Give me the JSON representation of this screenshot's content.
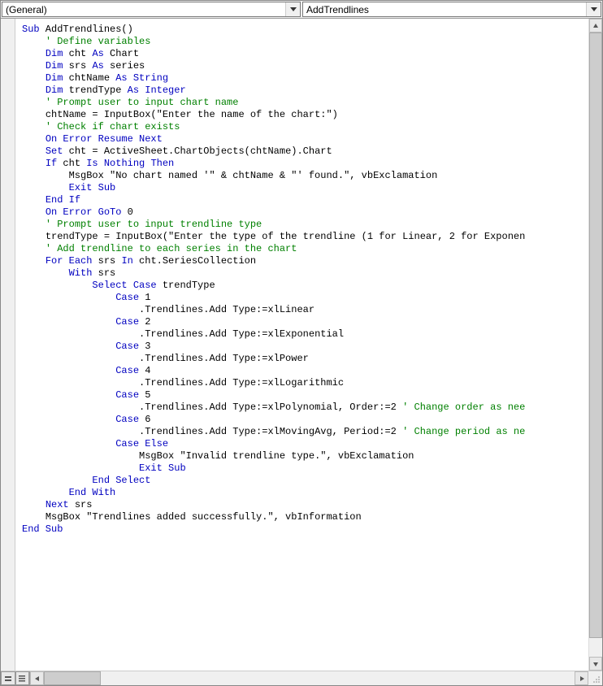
{
  "dropdowns": {
    "object": "(General)",
    "procedure": "AddTrendlines"
  },
  "code": {
    "lines": [
      {
        "indent": 0,
        "segs": [
          {
            "c": "kw",
            "t": "Sub"
          },
          {
            "c": "ms",
            "t": " AddTrendlines()"
          }
        ]
      },
      {
        "indent": 0,
        "segs": []
      },
      {
        "indent": 1,
        "segs": [
          {
            "c": "cm",
            "t": "' Define variables"
          }
        ]
      },
      {
        "indent": 1,
        "segs": [
          {
            "c": "kw",
            "t": "Dim"
          },
          {
            "c": "ms",
            "t": " cht "
          },
          {
            "c": "kw",
            "t": "As"
          },
          {
            "c": "ms",
            "t": " Chart"
          }
        ]
      },
      {
        "indent": 1,
        "segs": [
          {
            "c": "kw",
            "t": "Dim"
          },
          {
            "c": "ms",
            "t": " srs "
          },
          {
            "c": "kw",
            "t": "As"
          },
          {
            "c": "ms",
            "t": " series"
          }
        ]
      },
      {
        "indent": 1,
        "segs": [
          {
            "c": "kw",
            "t": "Dim"
          },
          {
            "c": "ms",
            "t": " chtName "
          },
          {
            "c": "kw",
            "t": "As String"
          }
        ]
      },
      {
        "indent": 1,
        "segs": [
          {
            "c": "kw",
            "t": "Dim"
          },
          {
            "c": "ms",
            "t": " trendType "
          },
          {
            "c": "kw",
            "t": "As Integer"
          }
        ]
      },
      {
        "indent": 0,
        "segs": []
      },
      {
        "indent": 1,
        "segs": [
          {
            "c": "cm",
            "t": "' Prompt user to input chart name"
          }
        ]
      },
      {
        "indent": 1,
        "segs": [
          {
            "c": "ms",
            "t": "chtName = InputBox(\"Enter the name of the chart:\")"
          }
        ]
      },
      {
        "indent": 0,
        "segs": []
      },
      {
        "indent": 1,
        "segs": [
          {
            "c": "cm",
            "t": "' Check if chart exists"
          }
        ]
      },
      {
        "indent": 1,
        "segs": [
          {
            "c": "kw",
            "t": "On Error Resume Next"
          }
        ]
      },
      {
        "indent": 1,
        "segs": [
          {
            "c": "kw",
            "t": "Set"
          },
          {
            "c": "ms",
            "t": " cht = ActiveSheet.ChartObjects(chtName).Chart"
          }
        ]
      },
      {
        "indent": 1,
        "segs": [
          {
            "c": "kw",
            "t": "If"
          },
          {
            "c": "ms",
            "t": " cht "
          },
          {
            "c": "kw",
            "t": "Is Nothing Then"
          }
        ]
      },
      {
        "indent": 2,
        "segs": [
          {
            "c": "ms",
            "t": "MsgBox \"No chart named '\" & chtName & \"' found.\", vbExclamation"
          }
        ]
      },
      {
        "indent": 2,
        "segs": [
          {
            "c": "kw",
            "t": "Exit Sub"
          }
        ]
      },
      {
        "indent": 1,
        "segs": [
          {
            "c": "kw",
            "t": "End If"
          }
        ]
      },
      {
        "indent": 1,
        "segs": [
          {
            "c": "kw",
            "t": "On Error GoTo"
          },
          {
            "c": "ms",
            "t": " 0"
          }
        ]
      },
      {
        "indent": 0,
        "segs": []
      },
      {
        "indent": 1,
        "segs": [
          {
            "c": "cm",
            "t": "' Prompt user to input trendline type"
          }
        ]
      },
      {
        "indent": 1,
        "segs": [
          {
            "c": "ms",
            "t": "trendType = InputBox(\"Enter the type of the trendline (1 for Linear, 2 for Exponen"
          }
        ]
      },
      {
        "indent": 0,
        "segs": []
      },
      {
        "indent": 1,
        "segs": [
          {
            "c": "cm",
            "t": "' Add trendline to each series in the chart"
          }
        ]
      },
      {
        "indent": 1,
        "segs": [
          {
            "c": "kw",
            "t": "For Each"
          },
          {
            "c": "ms",
            "t": " srs "
          },
          {
            "c": "kw",
            "t": "In"
          },
          {
            "c": "ms",
            "t": " cht.SeriesCollection"
          }
        ]
      },
      {
        "indent": 2,
        "segs": [
          {
            "c": "kw",
            "t": "With"
          },
          {
            "c": "ms",
            "t": " srs"
          }
        ]
      },
      {
        "indent": 3,
        "segs": [
          {
            "c": "kw",
            "t": "Select Case"
          },
          {
            "c": "ms",
            "t": " trendType"
          }
        ]
      },
      {
        "indent": 4,
        "segs": [
          {
            "c": "kw",
            "t": "Case"
          },
          {
            "c": "ms",
            "t": " 1"
          }
        ]
      },
      {
        "indent": 5,
        "segs": [
          {
            "c": "ms",
            "t": ".Trendlines.Add Type:=xlLinear"
          }
        ]
      },
      {
        "indent": 4,
        "segs": [
          {
            "c": "kw",
            "t": "Case"
          },
          {
            "c": "ms",
            "t": " 2"
          }
        ]
      },
      {
        "indent": 5,
        "segs": [
          {
            "c": "ms",
            "t": ".Trendlines.Add Type:=xlExponential"
          }
        ]
      },
      {
        "indent": 4,
        "segs": [
          {
            "c": "kw",
            "t": "Case"
          },
          {
            "c": "ms",
            "t": " 3"
          }
        ]
      },
      {
        "indent": 5,
        "segs": [
          {
            "c": "ms",
            "t": ".Trendlines.Add Type:=xlPower"
          }
        ]
      },
      {
        "indent": 4,
        "segs": [
          {
            "c": "kw",
            "t": "Case"
          },
          {
            "c": "ms",
            "t": " 4"
          }
        ]
      },
      {
        "indent": 5,
        "segs": [
          {
            "c": "ms",
            "t": ".Trendlines.Add Type:=xlLogarithmic"
          }
        ]
      },
      {
        "indent": 4,
        "segs": [
          {
            "c": "kw",
            "t": "Case"
          },
          {
            "c": "ms",
            "t": " 5"
          }
        ]
      },
      {
        "indent": 5,
        "segs": [
          {
            "c": "ms",
            "t": ".Trendlines.Add Type:=xlPolynomial, Order:=2 "
          },
          {
            "c": "cm",
            "t": "' Change order as nee"
          }
        ]
      },
      {
        "indent": 4,
        "segs": [
          {
            "c": "kw",
            "t": "Case"
          },
          {
            "c": "ms",
            "t": " 6"
          }
        ]
      },
      {
        "indent": 5,
        "segs": [
          {
            "c": "ms",
            "t": ".Trendlines.Add Type:=xlMovingAvg, Period:=2 "
          },
          {
            "c": "cm",
            "t": "' Change period as ne"
          }
        ]
      },
      {
        "indent": 4,
        "segs": [
          {
            "c": "kw",
            "t": "Case Else"
          }
        ]
      },
      {
        "indent": 5,
        "segs": [
          {
            "c": "ms",
            "t": "MsgBox \"Invalid trendline type.\", vbExclamation"
          }
        ]
      },
      {
        "indent": 5,
        "segs": [
          {
            "c": "kw",
            "t": "Exit Sub"
          }
        ]
      },
      {
        "indent": 3,
        "segs": [
          {
            "c": "kw",
            "t": "End Select"
          }
        ]
      },
      {
        "indent": 2,
        "segs": [
          {
            "c": "kw",
            "t": "End With"
          }
        ]
      },
      {
        "indent": 1,
        "segs": [
          {
            "c": "kw",
            "t": "Next"
          },
          {
            "c": "ms",
            "t": " srs"
          }
        ]
      },
      {
        "indent": 0,
        "segs": []
      },
      {
        "indent": 1,
        "segs": [
          {
            "c": "ms",
            "t": "MsgBox \"Trendlines added successfully.\", vbInformation"
          }
        ]
      },
      {
        "indent": 0,
        "segs": []
      },
      {
        "indent": 0,
        "segs": [
          {
            "c": "kw",
            "t": "End Sub"
          }
        ]
      }
    ]
  }
}
